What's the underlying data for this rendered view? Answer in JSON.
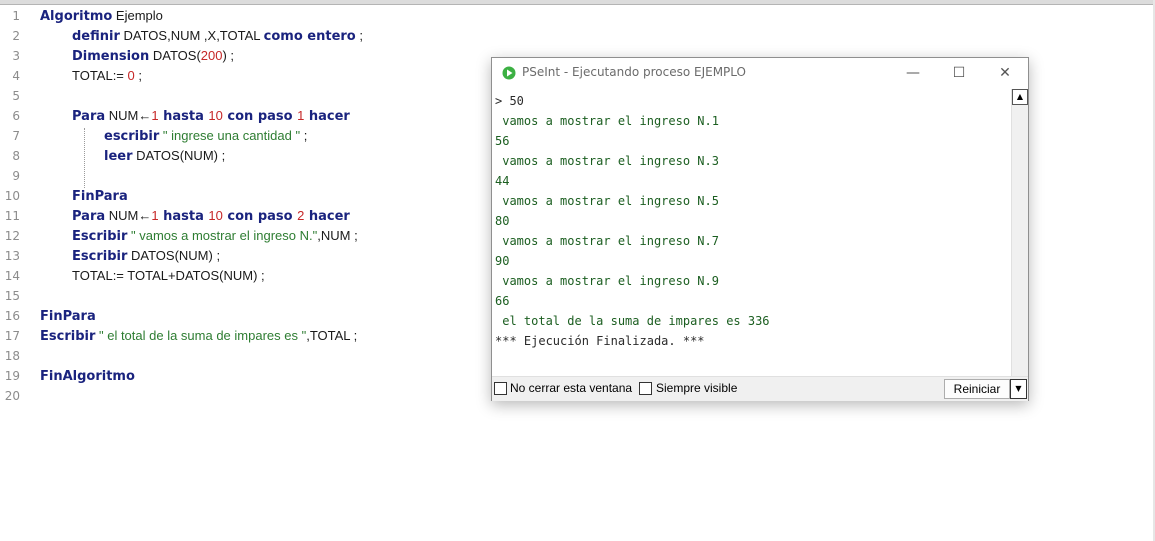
{
  "editor": {
    "lines": [
      {
        "n": "1",
        "tokens": [
          {
            "t": "kw",
            "v": "Algoritmo"
          },
          {
            "t": "tx",
            "v": " Ejemplo"
          }
        ]
      },
      {
        "n": "2",
        "tokens": [
          {
            "t": "kw",
            "v": "definir"
          },
          {
            "t": "tx",
            "v": " DATOS,NUM ,X,TOTAL "
          },
          {
            "t": "kw",
            "v": "como entero"
          },
          {
            "t": "tx",
            "v": " ;"
          }
        ]
      },
      {
        "n": "3",
        "tokens": [
          {
            "t": "kw",
            "v": "Dimension"
          },
          {
            "t": "tx",
            "v": " DATOS("
          },
          {
            "t": "num",
            "v": "200"
          },
          {
            "t": "tx",
            "v": ") ;"
          }
        ]
      },
      {
        "n": "4",
        "tokens": [
          {
            "t": "tx",
            "v": "TOTAL:= "
          },
          {
            "t": "num",
            "v": "0"
          },
          {
            "t": "tx",
            "v": " ;"
          }
        ]
      },
      {
        "n": "5",
        "tokens": []
      },
      {
        "n": "6",
        "tokens": [
          {
            "t": "kw",
            "v": "Para"
          },
          {
            "t": "tx",
            "v": " NUM←"
          },
          {
            "t": "num",
            "v": "1"
          },
          {
            "t": "kw",
            "v": " hasta "
          },
          {
            "t": "num",
            "v": "10"
          },
          {
            "t": "kw",
            "v": " con paso "
          },
          {
            "t": "num",
            "v": "1"
          },
          {
            "t": "kw",
            "v": " hacer"
          }
        ]
      },
      {
        "n": "7",
        "tokens": [
          {
            "t": "kw",
            "v": "escribir"
          },
          {
            "t": "str",
            "v": " \" ingrese una cantidad \""
          },
          {
            "t": "tx",
            "v": " ;"
          }
        ]
      },
      {
        "n": "8",
        "tokens": [
          {
            "t": "kw",
            "v": "leer"
          },
          {
            "t": "tx",
            "v": " DATOS(NUM) ;"
          }
        ]
      },
      {
        "n": "9",
        "tokens": []
      },
      {
        "n": "10",
        "tokens": [
          {
            "t": "kw",
            "v": "FinPara"
          }
        ]
      },
      {
        "n": "11",
        "tokens": [
          {
            "t": "kw",
            "v": "Para"
          },
          {
            "t": "tx",
            "v": " NUM←"
          },
          {
            "t": "num",
            "v": "1"
          },
          {
            "t": "kw",
            "v": " hasta "
          },
          {
            "t": "num",
            "v": "10"
          },
          {
            "t": "kw",
            "v": " con paso "
          },
          {
            "t": "num",
            "v": "2"
          },
          {
            "t": "kw",
            "v": " hacer"
          }
        ]
      },
      {
        "n": "12",
        "tokens": [
          {
            "t": "kw",
            "v": "Escribir"
          },
          {
            "t": "str",
            "v": " \" vamos a mostrar el ingreso N.\""
          },
          {
            "t": "tx",
            "v": ",NUM ;"
          }
        ]
      },
      {
        "n": "13",
        "tokens": [
          {
            "t": "kw",
            "v": "Escribir"
          },
          {
            "t": "tx",
            "v": " DATOS(NUM) ;"
          }
        ]
      },
      {
        "n": "14",
        "tokens": [
          {
            "t": "tx",
            "v": "TOTAL:= TOTAL+DATOS(NUM) ;"
          }
        ]
      },
      {
        "n": "15",
        "tokens": []
      },
      {
        "n": "16",
        "tokens": [
          {
            "t": "kw",
            "v": "FinPara"
          }
        ]
      },
      {
        "n": "17",
        "tokens": [
          {
            "t": "kw",
            "v": "Escribir"
          },
          {
            "t": "str",
            "v": " \" el total de la suma de impares es \""
          },
          {
            "t": "tx",
            "v": ",TOTAL ;"
          }
        ]
      },
      {
        "n": "18",
        "tokens": []
      },
      {
        "n": "19",
        "tokens": [
          {
            "t": "kw",
            "v": "FinAlgoritmo"
          }
        ]
      },
      {
        "n": "20",
        "tokens": []
      }
    ]
  },
  "console": {
    "title": "PSeInt - Ejecutando proceso EJEMPLO",
    "icon": "play-icon",
    "window_buttons": {
      "minimize": "—",
      "maximize": "☐",
      "close": "✕"
    },
    "output": [
      {
        "text": "> 50",
        "style": "dark"
      },
      {
        "text": " vamos a mostrar el ingreso N.1",
        "style": "green"
      },
      {
        "text": "56",
        "style": "green"
      },
      {
        "text": " vamos a mostrar el ingreso N.3",
        "style": "green"
      },
      {
        "text": "44",
        "style": "green"
      },
      {
        "text": " vamos a mostrar el ingreso N.5",
        "style": "green"
      },
      {
        "text": "80",
        "style": "green"
      },
      {
        "text": " vamos a mostrar el ingreso N.7",
        "style": "green"
      },
      {
        "text": "90",
        "style": "green"
      },
      {
        "text": " vamos a mostrar el ingreso N.9",
        "style": "green"
      },
      {
        "text": "66",
        "style": "green"
      },
      {
        "text": " el total de la suma de impares es 336",
        "style": "green"
      },
      {
        "text": "*** Ejecución Finalizada. ***",
        "style": "dark"
      }
    ],
    "checkbox_no_cerrar": "No cerrar esta ventana",
    "checkbox_siempre_visible": "Siempre visible",
    "restart_label": "Reiniciar",
    "scroll_up_glyph": "▲",
    "dropdown_glyph": "▼"
  }
}
